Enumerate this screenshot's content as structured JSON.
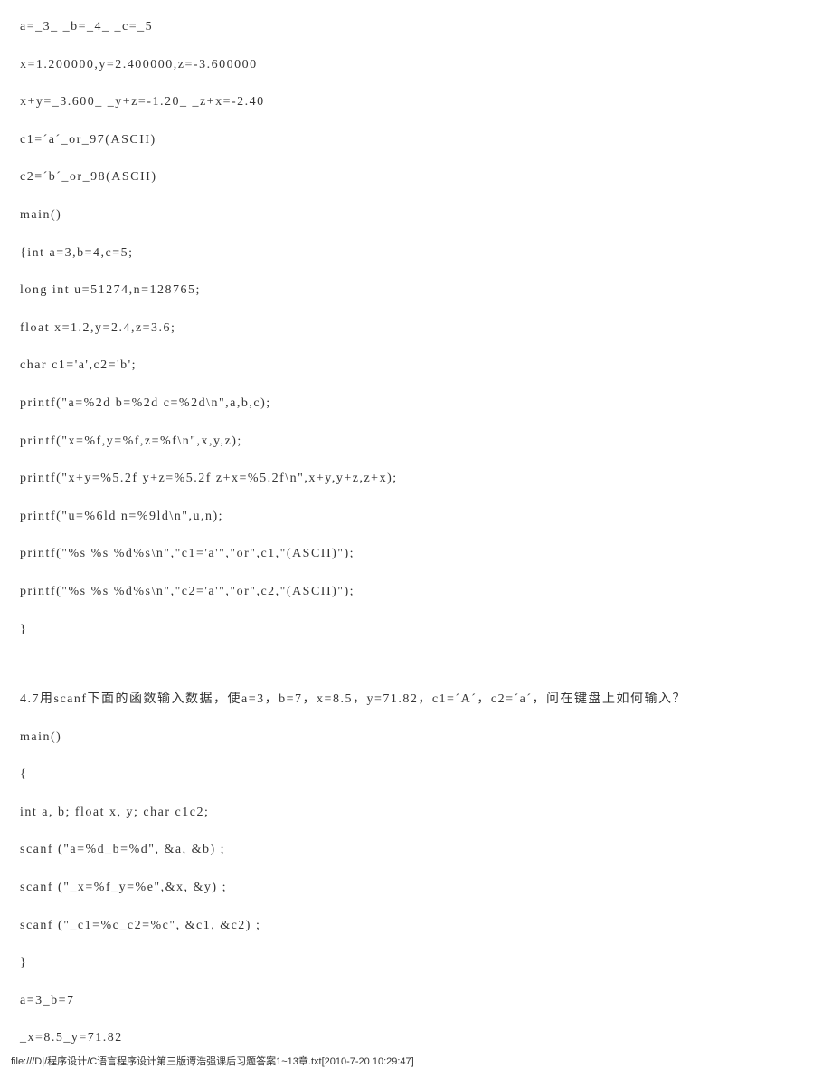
{
  "lines": [
    "a=_3_ _b=_4_ _c=_5",
    "x=1.200000,y=2.400000,z=-3.600000",
    "x+y=_3.600_ _y+z=-1.20_ _z+x=-2.40",
    "c1=ˊaˊ_or_97(ASCII)",
    "c2=ˊbˊ_or_98(ASCII)",
    "main()",
    "{int a=3,b=4,c=5;",
    "long int u=51274,n=128765;",
    "float x=1.2,y=2.4,z=3.6;",
    "char c1='a',c2='b';",
    "printf(\"a=%2d b=%2d c=%2d\\n\",a,b,c);",
    "printf(\"x=%f,y=%f,z=%f\\n\",x,y,z);",
    "printf(\"x+y=%5.2f y+z=%5.2f z+x=%5.2f\\n\",x+y,y+z,z+x);",
    "printf(\"u=%6ld n=%9ld\\n\",u,n);",
    "printf(\"%s %s %d%s\\n\",\"c1='a'\",\"or\",c1,\"(ASCII)\");",
    "printf(\"%s %s %d%s\\n\",\"c2='a'\",\"or\",c2,\"(ASCII)\");",
    "}",
    "",
    "4.7用scanf下面的函数输入数据，使a=3，b=7，x=8.5，y=71.82，c1=ˊAˊ，c2=ˊaˊ，问在键盘上如何输入？",
    "main()",
    "{",
    "int a, b; float x, y; char c1c2;",
    "scanf (\"a=%d_b=%d\", &a, &b) ;",
    "scanf (\"_x=%f_y=%e\",&x, &y) ;",
    "scanf (\"_c1=%c_c2=%c\", &c1, &c2) ;",
    "}",
    "a=3_b=7",
    "_x=8.5_y=71.82"
  ],
  "footer": "file:///D|/程序设计/C语言程序设计第三版谭浩强课后习题答案1~13章.txt[2010-7-20 10:29:47]"
}
